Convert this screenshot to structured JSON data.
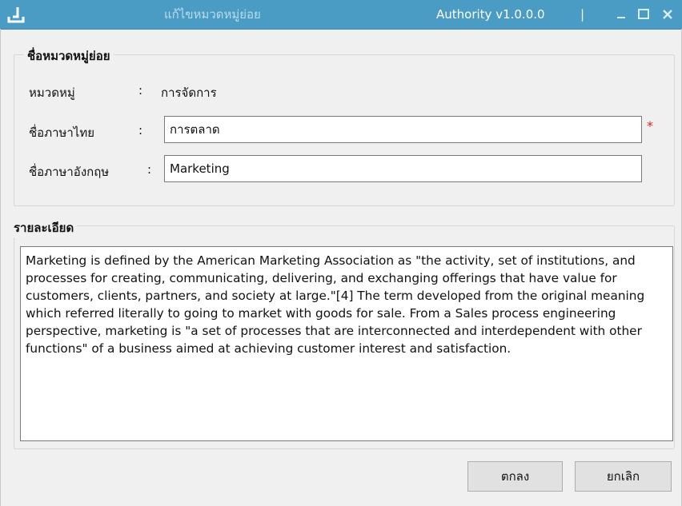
{
  "window": {
    "title": "แก้ไขหมวดหมู่ย่อย",
    "app_name": "Authority v1.0.0.0",
    "separator": "|"
  },
  "subcategory_group": {
    "legend": "ชื่อหมวดหมู่ย่อย",
    "category_label": "หมวดหมู่",
    "category_colon": ":",
    "category_value": "การจัดการ",
    "thai_name_label": "ชื่อภาษาไทย",
    "thai_name_colon": ":",
    "thai_name_value": "การตลาด",
    "required_mark": "*",
    "english_name_label": "ชื่อภาษาอังกฤษ",
    "english_name_colon": ":",
    "english_name_value": "Marketing"
  },
  "detail_group": {
    "legend": "รายละเอียด",
    "text": "Marketing is defined by the American Marketing Association as \"the activity, set of institutions, and processes for creating, communicating, delivering, and exchanging offerings that have value for customers, clients, partners, and society at large.\"[4] The term developed from the original meaning which referred literally to going to market with goods for sale. From a Sales process engineering perspective, marketing is \"a set of processes that are interconnected and interdependent with other functions\" of a business aimed at achieving customer interest and satisfaction."
  },
  "buttons": {
    "ok": "ตกลง",
    "cancel": "ยกเลิก"
  },
  "colors": {
    "titlebar": "#4a9cc4",
    "required": "#e02020"
  },
  "icons": [
    "app-icon",
    "minimize-icon",
    "maximize-icon",
    "close-icon"
  ]
}
